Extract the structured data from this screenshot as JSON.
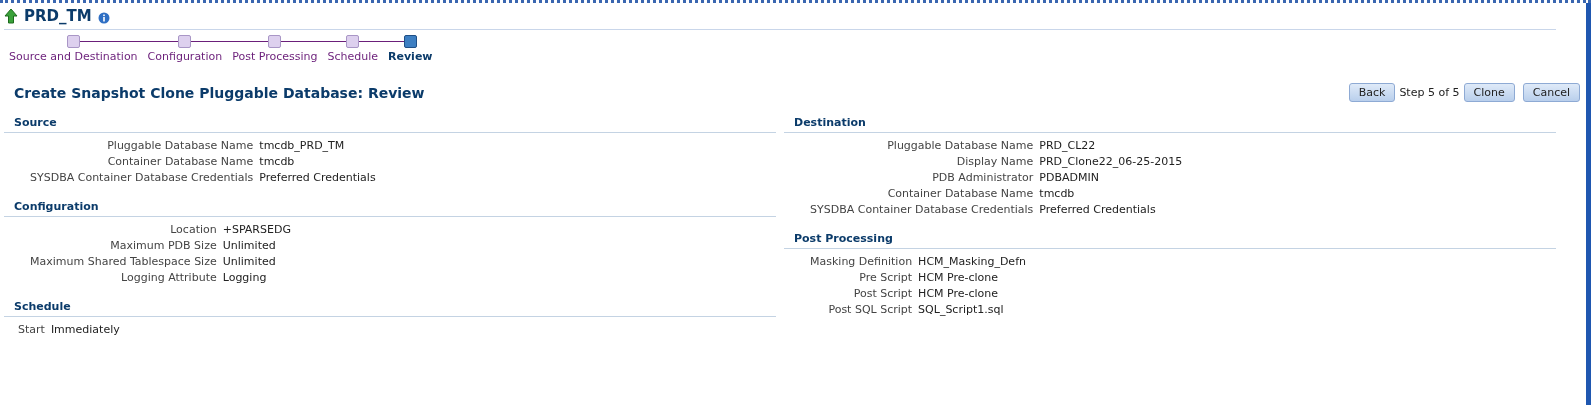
{
  "header": {
    "title": "PRD_TM"
  },
  "train": [
    {
      "label": "Source and Destination",
      "selected": false
    },
    {
      "label": "Configuration",
      "selected": false
    },
    {
      "label": "Post Processing",
      "selected": false
    },
    {
      "label": "Schedule",
      "selected": false
    },
    {
      "label": "Review",
      "selected": true
    }
  ],
  "page_title": "Create Snapshot Clone Pluggable Database: Review",
  "toolbar": {
    "back": "Back",
    "step": "Step 5 of 5",
    "clone": "Clone",
    "cancel": "Cancel"
  },
  "left_sections": [
    {
      "heading": "Source",
      "fields": [
        {
          "label": "Pluggable Database Name",
          "value": "tmcdb_PRD_TM"
        },
        {
          "label": "Container Database Name",
          "value": "tmcdb"
        },
        {
          "label": "SYSDBA Container Database Credentials",
          "value": "Preferred Credentials"
        }
      ]
    },
    {
      "heading": "Configuration",
      "fields": [
        {
          "label": "Location",
          "value": "+SPARSEDG"
        },
        {
          "label": "Maximum PDB Size",
          "value": "Unlimited"
        },
        {
          "label": "Maximum Shared Tablespace Size",
          "value": "Unlimited"
        },
        {
          "label": "Logging Attribute",
          "value": "Logging"
        }
      ]
    },
    {
      "heading": "Schedule",
      "fields": [
        {
          "label": "Start",
          "value": "Immediately"
        }
      ]
    }
  ],
  "right_sections": [
    {
      "heading": "Destination",
      "fields": [
        {
          "label": "Pluggable Database Name",
          "value": "PRD_CL22"
        },
        {
          "label": "Display Name",
          "value": "PRD_Clone22_06-25-2015"
        },
        {
          "label": "PDB Administrator",
          "value": "PDBADMIN"
        },
        {
          "label": "Container Database Name",
          "value": "tmcdb"
        },
        {
          "label": "SYSDBA Container Database Credentials",
          "value": "Preferred Credentials"
        }
      ]
    },
    {
      "heading": "Post Processing",
      "fields": [
        {
          "label": "Masking Definition",
          "value": "HCM_Masking_Defn"
        },
        {
          "label": "Pre Script",
          "value": "HCM Pre-clone"
        },
        {
          "label": "Post Script",
          "value": "HCM Pre-clone"
        },
        {
          "label": "Post SQL Script",
          "value": "SQL_Script1.sql"
        }
      ]
    }
  ]
}
